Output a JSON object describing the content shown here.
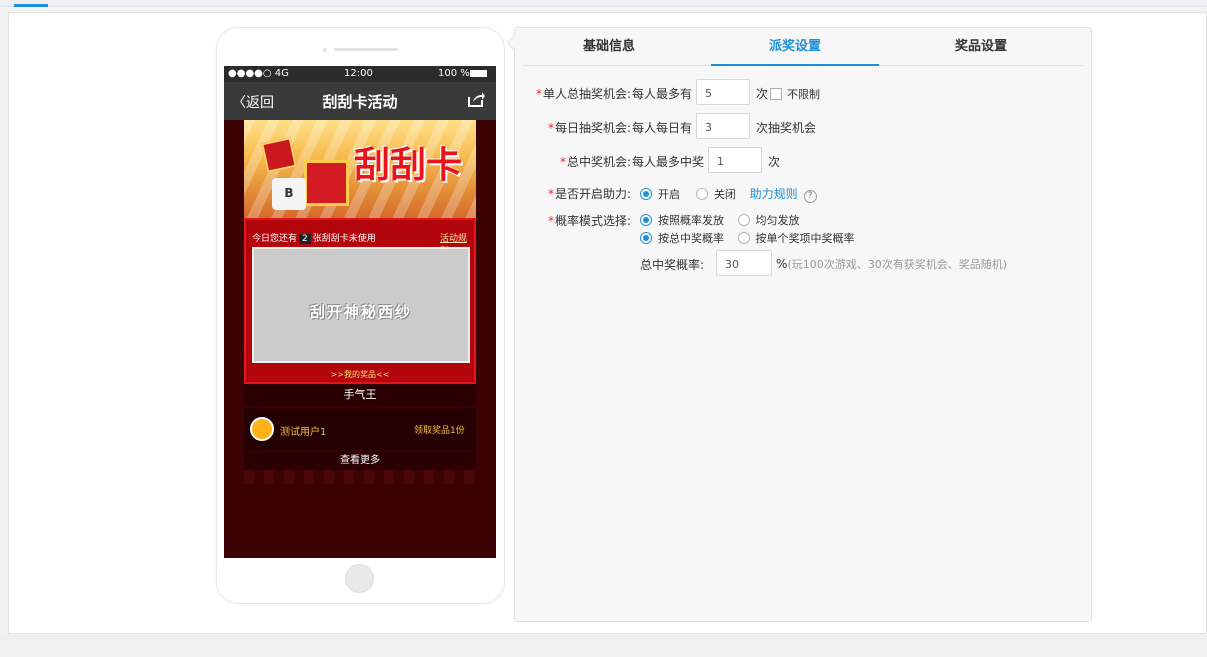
{
  "phone": {
    "status": {
      "carrier": "●●●●○ 4G",
      "time": "12:00",
      "battery": "100 %"
    },
    "nav": {
      "back": "〈返回",
      "title": "刮刮卡活动"
    },
    "banner_title": "刮刮卡",
    "mug_label": "B",
    "card": {
      "info_prefix": "今日您还有",
      "count": "2",
      "info_suffix": "张刮刮卡未使用",
      "rules_link": "活动规则",
      "scratch_text": "刮开神秘西纱",
      "my_prize": ">>我的奖品<<"
    },
    "winners_title": "手气王",
    "winner": {
      "name": "测试用户1",
      "prize": "领取奖品1份"
    },
    "more": "查看更多"
  },
  "tabs": [
    {
      "label": "基础信息"
    },
    {
      "label": "派奖设置"
    },
    {
      "label": "奖品设置"
    }
  ],
  "form": {
    "total_chance": {
      "label": "单人总抽奖机会:",
      "prefix": "每人最多有",
      "value": "5",
      "unit": "次",
      "unlimited": "不限制"
    },
    "daily_chance": {
      "label": "每日抽奖机会:",
      "prefix": "每人每日有",
      "value": "3",
      "unit": "次抽奖机会"
    },
    "total_win": {
      "label": "总中奖机会:",
      "prefix": "每人最多中奖",
      "value": "1",
      "unit": "次"
    },
    "assist": {
      "label": "是否开启助力:",
      "on": "开启",
      "off": "关闭",
      "rules_link": "助力规则",
      "help": "?"
    },
    "prob_mode": {
      "label": "概率模式选择:",
      "opt1": "按照概率发放",
      "opt2": "均匀发放",
      "opt3": "按总中奖概率",
      "opt4": "按单个奖项中奖概率"
    },
    "total_prob": {
      "label": "总中奖概率:",
      "value": "30",
      "unit": "%",
      "hint": "(玩100次游戏、30次有获奖机会、奖品随机)"
    }
  },
  "colors": {
    "accent": "#1e8fd9",
    "required": "#ee2233"
  }
}
